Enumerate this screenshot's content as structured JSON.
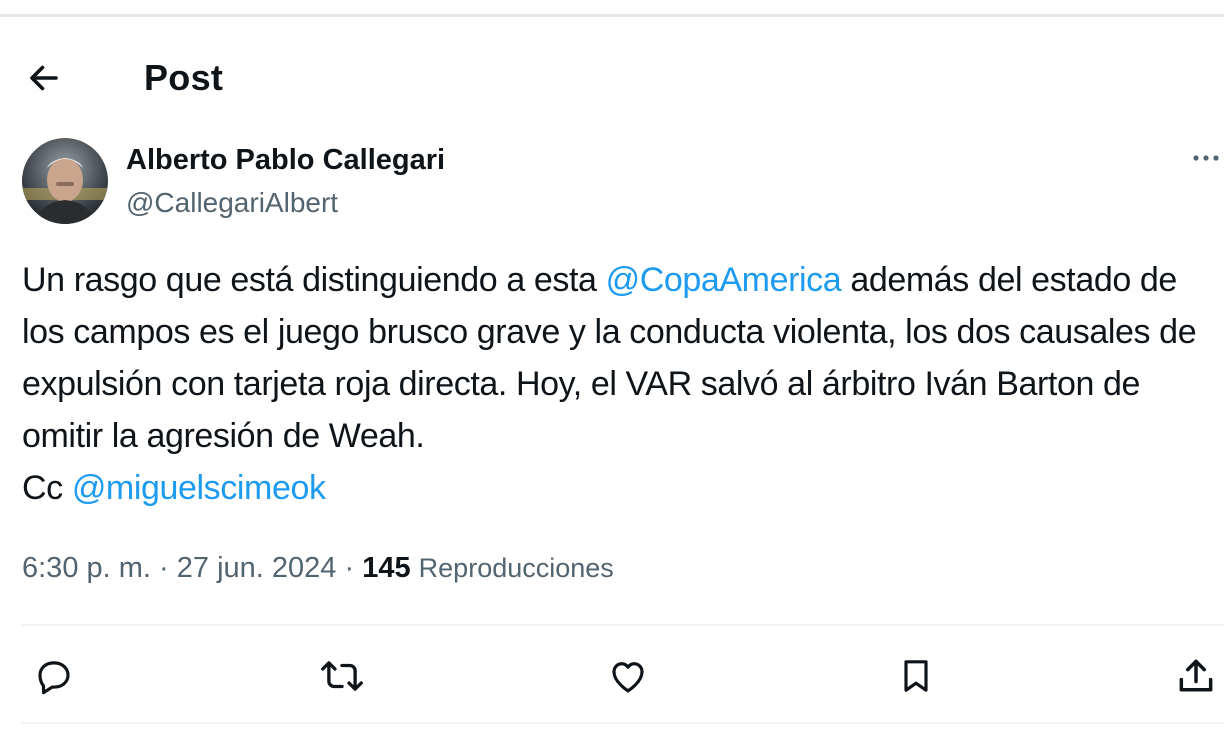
{
  "header": {
    "title": "Post",
    "back_icon": "arrow-left-icon"
  },
  "author": {
    "display_name": "Alberto Pablo Callegari",
    "handle": "@CallegariAlbert",
    "avatar_icon": "avatar",
    "more_icon": "more-horizontal-icon"
  },
  "tweet": {
    "segments": [
      {
        "text": "Un rasgo que está distinguiendo a esta ",
        "type": "text"
      },
      {
        "text": "@CopaAmerica",
        "type": "mention"
      },
      {
        "text": " además del estado de los campos es el juego brusco grave y la conducta violenta, los dos causales de expulsión con tarjeta roja directa. Hoy, el VAR salvó al árbitro Iván Barton de omitir la agresión de Weah.",
        "type": "text"
      },
      {
        "text": "Cc ",
        "type": "text"
      },
      {
        "text": "@miguelscimeok",
        "type": "mention"
      }
    ]
  },
  "meta": {
    "time": "6:30 p. m.",
    "separator": "·",
    "date": "27 jun. 2024",
    "views_count": "145",
    "views_label": "Reproducciones"
  },
  "actions": [
    "reply-icon",
    "repost-icon",
    "like-icon",
    "bookmark-icon",
    "share-icon"
  ],
  "colors": {
    "text": "#0f1419",
    "secondary": "#536471",
    "link": "#1d9bf0",
    "divider": "#eff3f4"
  }
}
